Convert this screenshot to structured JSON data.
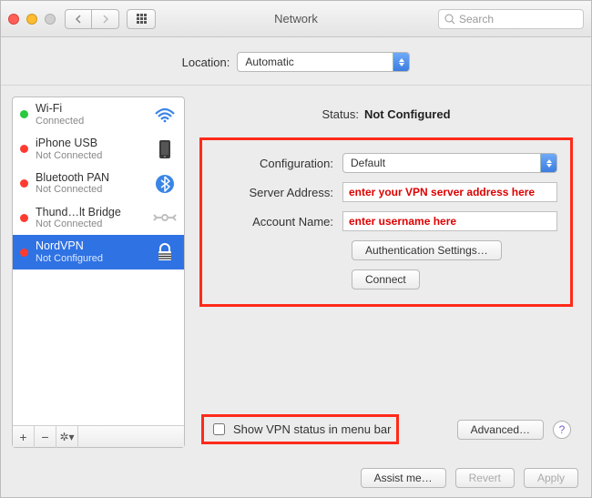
{
  "window_title": "Network",
  "search": {
    "placeholder": "Search"
  },
  "location": {
    "label": "Location:",
    "value": "Automatic"
  },
  "sidebar": {
    "items": [
      {
        "name": "Wi-Fi",
        "sub": "Connected",
        "status": "green",
        "icon": "wifi-icon"
      },
      {
        "name": "iPhone USB",
        "sub": "Not Connected",
        "status": "red",
        "icon": "phone-icon"
      },
      {
        "name": "Bluetooth PAN",
        "sub": "Not Connected",
        "status": "red",
        "icon": "bluetooth-icon"
      },
      {
        "name": "Thund…lt Bridge",
        "sub": "Not Connected",
        "status": "red",
        "icon": "thunderbolt-icon"
      },
      {
        "name": "NordVPN",
        "sub": "Not Configured",
        "status": "red",
        "icon": "lock-icon",
        "selected": true
      }
    ]
  },
  "status": {
    "label": "Status:",
    "value": "Not Configured"
  },
  "form": {
    "configuration_label": "Configuration:",
    "configuration_value": "Default",
    "server_label": "Server Address:",
    "server_placeholder": "enter your VPN server address here",
    "account_label": "Account Name:",
    "account_placeholder": "enter username here",
    "auth_button": "Authentication Settings…",
    "connect_button": "Connect"
  },
  "options": {
    "show_status_label": "Show VPN status in menu bar",
    "advanced_button": "Advanced…"
  },
  "footer": {
    "assist": "Assist me…",
    "revert": "Revert",
    "apply": "Apply"
  }
}
